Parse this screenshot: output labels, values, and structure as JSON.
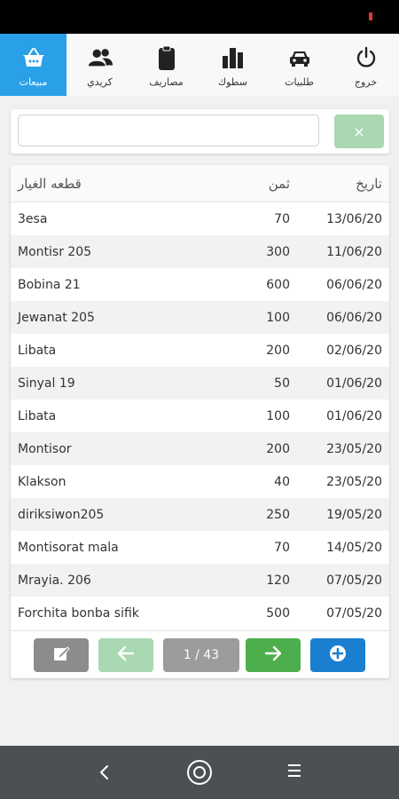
{
  "top_nav": {
    "items": [
      {
        "label": "خروج",
        "icon": "power-icon"
      },
      {
        "label": "طلبيات",
        "icon": "car-icon"
      },
      {
        "label": "سطوك",
        "icon": "bar-chart-icon"
      },
      {
        "label": "مصاريف",
        "icon": "clipboard-icon"
      },
      {
        "label": "كريدي",
        "icon": "users-icon"
      },
      {
        "label": "مبيعات",
        "icon": "basket-icon"
      }
    ],
    "active": "مبيعات"
  },
  "search": {
    "value": "",
    "placeholder": "",
    "clear_label": "×"
  },
  "table": {
    "headers": {
      "name": "قطعه الغيار",
      "price": "ثمن",
      "date": "تاريخ"
    },
    "rows": [
      {
        "name": "3esa",
        "price": "70",
        "date": "13/06/20"
      },
      {
        "name": "Montisr 205",
        "price": "300",
        "date": "11/06/20"
      },
      {
        "name": "Bobina 21",
        "price": "600",
        "date": "06/06/20"
      },
      {
        "name": "Jewanat 205",
        "price": "100",
        "date": "06/06/20"
      },
      {
        "name": "Libata",
        "price": "200",
        "date": "02/06/20"
      },
      {
        "name": "Sinyal 19",
        "price": "50",
        "date": "01/06/20"
      },
      {
        "name": "Libata",
        "price": "100",
        "date": "01/06/20"
      },
      {
        "name": "Montisor",
        "price": "200",
        "date": "23/05/20"
      },
      {
        "name": "Klakson",
        "price": "40",
        "date": "23/05/20"
      },
      {
        "name": "diriksiwon205",
        "price": "250",
        "date": "19/05/20"
      },
      {
        "name": "Montisorat mala",
        "price": "70",
        "date": "14/05/20"
      },
      {
        "name": "Mrayia. 206",
        "price": "120",
        "date": "07/05/20"
      },
      {
        "name": "Forchita bonba sifik",
        "price": "500",
        "date": "07/05/20"
      }
    ]
  },
  "pager": {
    "page_text": "1 / 43"
  },
  "colors": {
    "accent": "#29a0e8",
    "next": "#4cae4c",
    "add": "#1a7fd1",
    "disabled_green": "#a9d8b2"
  }
}
